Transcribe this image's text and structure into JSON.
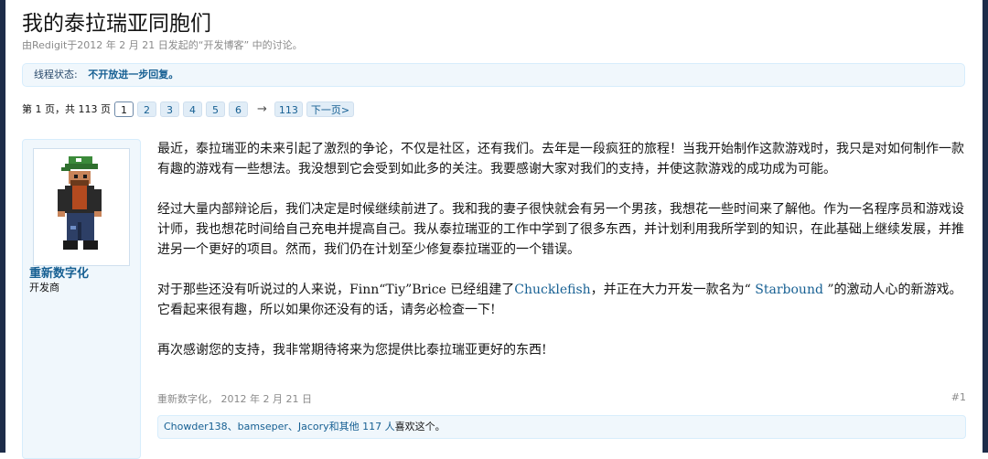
{
  "thread": {
    "title": "我的泰拉瑞亚同胞们",
    "byline": "由Redigit于2012 年 2 月 21 日发起的“开发博客” 中的讨论。"
  },
  "status": {
    "label": "线程状态:",
    "value": "不开放进一步回复。"
  },
  "pagination": {
    "summary": "第 1 页，共 113 页",
    "pages": [
      "1",
      "2",
      "3",
      "4",
      "5",
      "6"
    ],
    "current_page": "1",
    "arrow": "→",
    "last_page": "113",
    "next_label": "下一页>"
  },
  "post": {
    "author": "重新数字化",
    "author_title": "开发商",
    "paragraphs": [
      "最近，泰拉瑞亚的未来引起了激烈的争论，不仅是社区，还有我们。去年是一段疯狂的旅程！当我开始制作这款游戏时，我只是对如何制作一款有趣的游戏有一些想法。我没想到它会受到如此多的关注。我要感谢大家对我们的支持，并使这款游戏的成功成为可能。",
      "经过大量内部辩论后，我们决定是时候继续前进了。我和我的妻子很快就会有另一个男孩，我想花一些时间来了解他。作为一名程序员和游戏设计师，我也想花时间给自己充电并提高自己。我从泰拉瑞亚的工作中学到了很多东西，并计划利用我所学到的知识，在此基础上继续发展，并推进另一个更好的项目。然而，我们仍在计划至少修复泰拉瑞亚的一个错误。"
    ],
    "p3_before": "对于那些还没有听说过的人来说，Finn“Tiy”Brice 已经组建了",
    "p3_link1": "Chucklefish",
    "p3_middle": "，并正在大力开发一款名为“ ",
    "p3_link2": "Starbound",
    "p3_after": " ”的激动人心的新游戏。它看起来很有趣，所以如果你还没有的话，请务必检查一下!",
    "closing": "再次感谢您的支持，我非常期待将来为您提供比泰拉瑞亚更好的东西!",
    "meta": "重新数字化， 2012 年 2 月 21 日",
    "number": "#1",
    "likes_users": "Chowder138、bamseper、Jacory和其他 117 人",
    "likes_suffix": "喜欢这个。"
  }
}
